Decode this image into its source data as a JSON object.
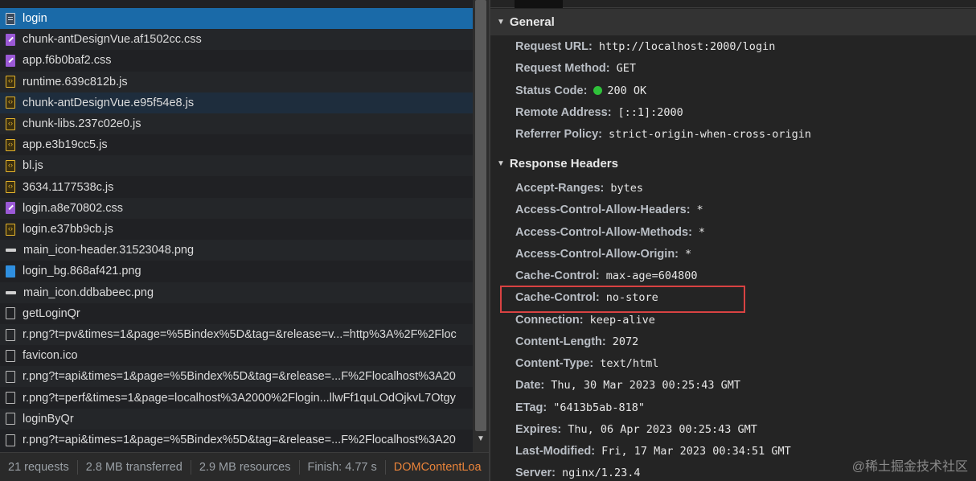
{
  "requests": [
    {
      "name": "login",
      "icon": "document-icon",
      "type": "doc",
      "state": "selected"
    },
    {
      "name": "chunk-antDesignVue.af1502cc.css",
      "icon": "stylesheet-icon",
      "type": "css",
      "state": "alt"
    },
    {
      "name": "app.f6b0baf2.css",
      "icon": "stylesheet-icon",
      "type": "css",
      "state": ""
    },
    {
      "name": "runtime.639c812b.js",
      "icon": "script-icon",
      "type": "js",
      "state": "alt"
    },
    {
      "name": "chunk-antDesignVue.e95f54e8.js",
      "icon": "script-icon",
      "type": "js",
      "state": "hover"
    },
    {
      "name": "chunk-libs.237c02e0.js",
      "icon": "script-icon",
      "type": "js",
      "state": "alt"
    },
    {
      "name": "app.e3b19cc5.js",
      "icon": "script-icon",
      "type": "js",
      "state": ""
    },
    {
      "name": "bl.js",
      "icon": "script-icon",
      "type": "js",
      "state": "alt"
    },
    {
      "name": "3634.1177538c.js",
      "icon": "script-icon",
      "type": "js",
      "state": ""
    },
    {
      "name": "login.a8e70802.css",
      "icon": "stylesheet-icon",
      "type": "css",
      "state": "alt"
    },
    {
      "name": "login.e37bb9cb.js",
      "icon": "script-icon",
      "type": "js",
      "state": ""
    },
    {
      "name": "main_icon-header.31523048.png",
      "icon": "image-icon",
      "type": "img",
      "state": "alt"
    },
    {
      "name": "login_bg.868af421.png",
      "icon": "image-icon",
      "type": "imgblue",
      "state": ""
    },
    {
      "name": "main_icon.ddbabeec.png",
      "icon": "image-icon",
      "type": "img",
      "state": "alt"
    },
    {
      "name": "getLoginQr",
      "icon": "xhr-icon",
      "type": "xhr",
      "state": ""
    },
    {
      "name": "r.png?t=pv&times=1&page=%5Bindex%5D&tag=&release=v...=http%3A%2F%2Floc",
      "icon": "xhr-icon",
      "type": "xhr",
      "state": "alt"
    },
    {
      "name": "favicon.ico",
      "icon": "xhr-icon",
      "type": "xhr",
      "state": ""
    },
    {
      "name": "r.png?t=api&times=1&page=%5Bindex%5D&tag=&release=...F%2Flocalhost%3A20",
      "icon": "xhr-icon",
      "type": "xhr",
      "state": "alt"
    },
    {
      "name": "r.png?t=perf&times=1&page=localhost%3A2000%2Flogin...llwFf1quLOdOjkvL7Otgy",
      "icon": "xhr-icon",
      "type": "xhr",
      "state": ""
    },
    {
      "name": "loginByQr",
      "icon": "xhr-icon",
      "type": "xhr",
      "state": "alt"
    },
    {
      "name": "r.png?t=api&times=1&page=%5Bindex%5D&tag=&release=...F%2Flocalhost%3A20",
      "icon": "xhr-icon",
      "type": "xhr",
      "state": ""
    }
  ],
  "status_bar": {
    "requests": "21 requests",
    "transferred": "2.8 MB transferred",
    "resources": "2.9 MB resources",
    "finish": "Finish: 4.77 s",
    "dom_content_loaded": "DOMContentLoa"
  },
  "general": {
    "title": "General",
    "rows": [
      {
        "name": "Request URL:",
        "value": "http://localhost:2000/login"
      },
      {
        "name": "Request Method:",
        "value": "GET"
      },
      {
        "name": "Status Code:",
        "value": "200 OK"
      },
      {
        "name": "Remote Address:",
        "value": "[::1]:2000"
      },
      {
        "name": "Referrer Policy:",
        "value": "strict-origin-when-cross-origin"
      }
    ]
  },
  "response_headers": {
    "title": "Response Headers",
    "rows": [
      {
        "name": "Accept-Ranges:",
        "value": "bytes"
      },
      {
        "name": "Access-Control-Allow-Headers:",
        "value": "*"
      },
      {
        "name": "Access-Control-Allow-Methods:",
        "value": "*"
      },
      {
        "name": "Access-Control-Allow-Origin:",
        "value": "*"
      },
      {
        "name": "Cache-Control:",
        "value": "max-age=604800"
      },
      {
        "name": "Cache-Control:",
        "value": "no-store"
      },
      {
        "name": "Connection:",
        "value": "keep-alive"
      },
      {
        "name": "Content-Length:",
        "value": "2072"
      },
      {
        "name": "Content-Type:",
        "value": "text/html"
      },
      {
        "name": "Date:",
        "value": "Thu, 30 Mar 2023 00:25:43 GMT"
      },
      {
        "name": "ETag:",
        "value": "\"6413b5ab-818\""
      },
      {
        "name": "Expires:",
        "value": "Thu, 06 Apr 2023 00:25:43 GMT"
      },
      {
        "name": "Last-Modified:",
        "value": "Fri, 17 Mar 2023 00:34:51 GMT"
      },
      {
        "name": "Server:",
        "value": "nginx/1.23.4"
      }
    ]
  },
  "watermark": "@稀土掘金技术社区",
  "colors": {
    "selected_row": "#1a6aa8",
    "highlight_box": "#d94242",
    "status_ok": "#2fc13a",
    "dom_loaded_text": "#e8833a"
  }
}
